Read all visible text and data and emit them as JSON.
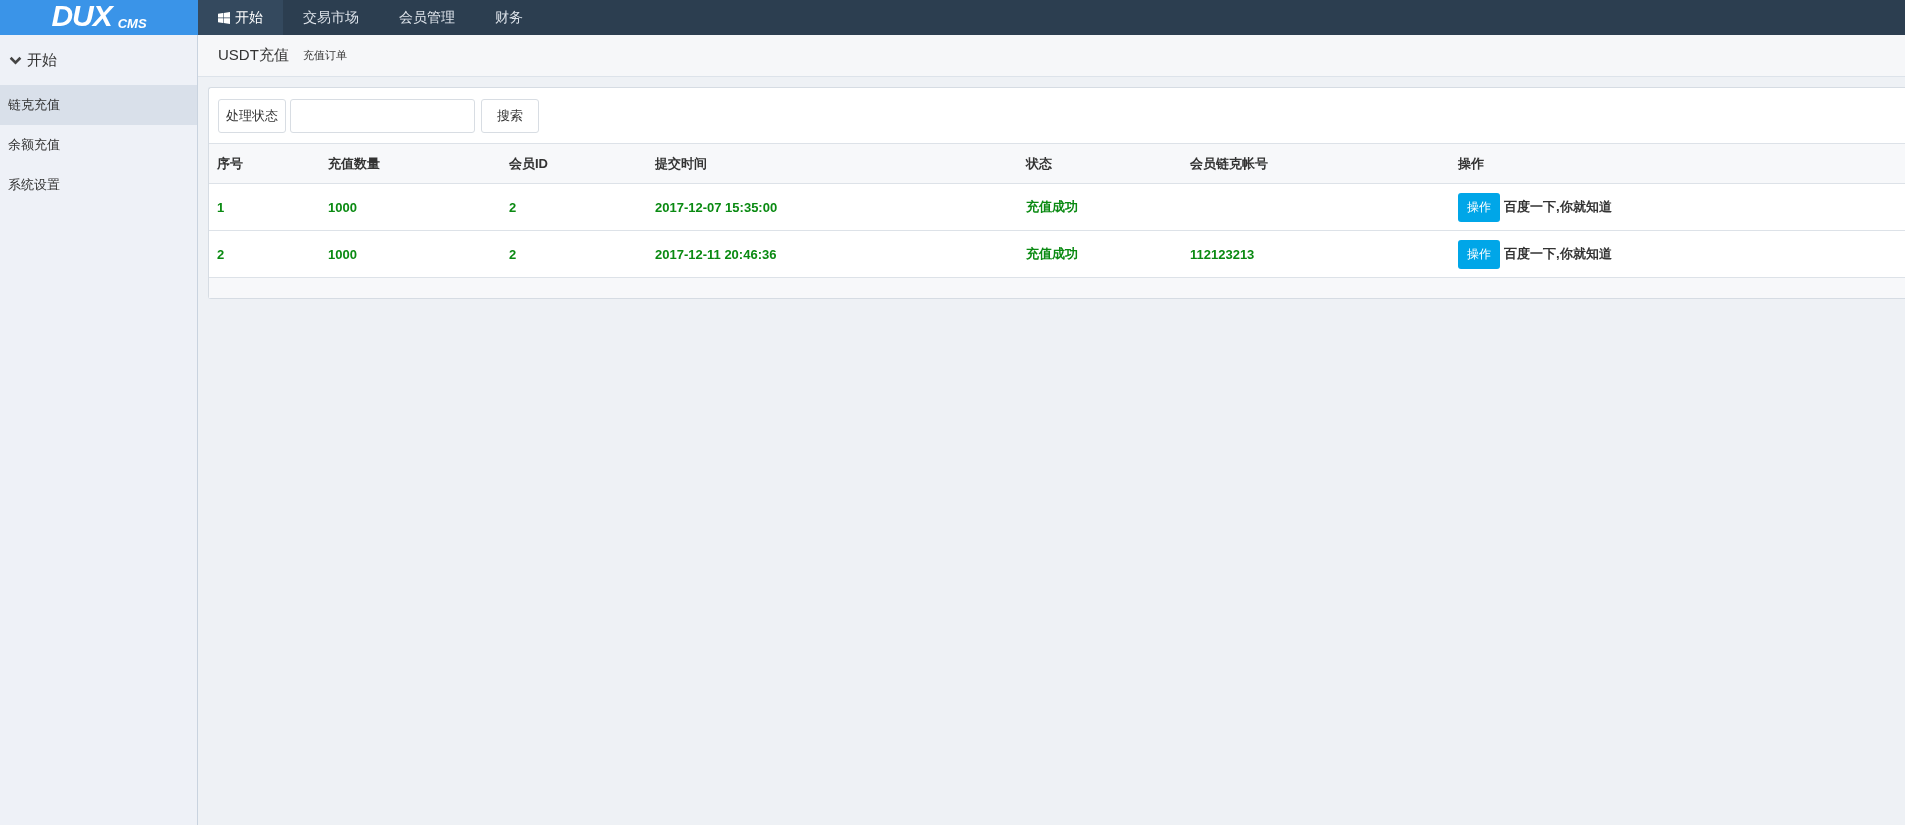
{
  "logo": {
    "main": "DUX",
    "sub": "CMS"
  },
  "top_nav": [
    {
      "label": "开始",
      "selected": true,
      "kind": "iconic"
    },
    {
      "label": "交易市场",
      "selected": false,
      "kind": "plain"
    },
    {
      "label": "会员管理",
      "selected": false,
      "kind": "plain"
    },
    {
      "label": "财务",
      "selected": false,
      "kind": "plain"
    }
  ],
  "sidebar": {
    "group": {
      "label": "开始",
      "expanded": true
    },
    "items": [
      {
        "label": "链克充值",
        "selected": true
      },
      {
        "label": "余额充值",
        "selected": false
      },
      {
        "label": "系统设置",
        "selected": false
      }
    ]
  },
  "page_header": {
    "title": "USDT充值",
    "subtitle": "充值订单"
  },
  "toolbar": {
    "filter_button": "处理状态",
    "search_button": "搜索"
  },
  "table": {
    "columns": [
      "序号",
      "充值数量",
      "会员ID",
      "提交时间",
      "状态",
      "会员链克帐号",
      "操作"
    ],
    "rows": [
      {
        "no": "1",
        "amount": "1000",
        "member_id": "2",
        "time": "2017-12-07 15:35:00",
        "status": "充值成功",
        "action_button": "操作",
        "action_text": "百度一下,你就知道"
      },
      {
        "no": "2",
        "amount": "1000",
        "member_id": "2",
        "time": "2017-12-11 20:46:36",
        "status": "充值成功",
        "account": "112123213",
        "action_button": "操作",
        "action_text": "百度一下,你就知道"
      }
    ]
  }
}
